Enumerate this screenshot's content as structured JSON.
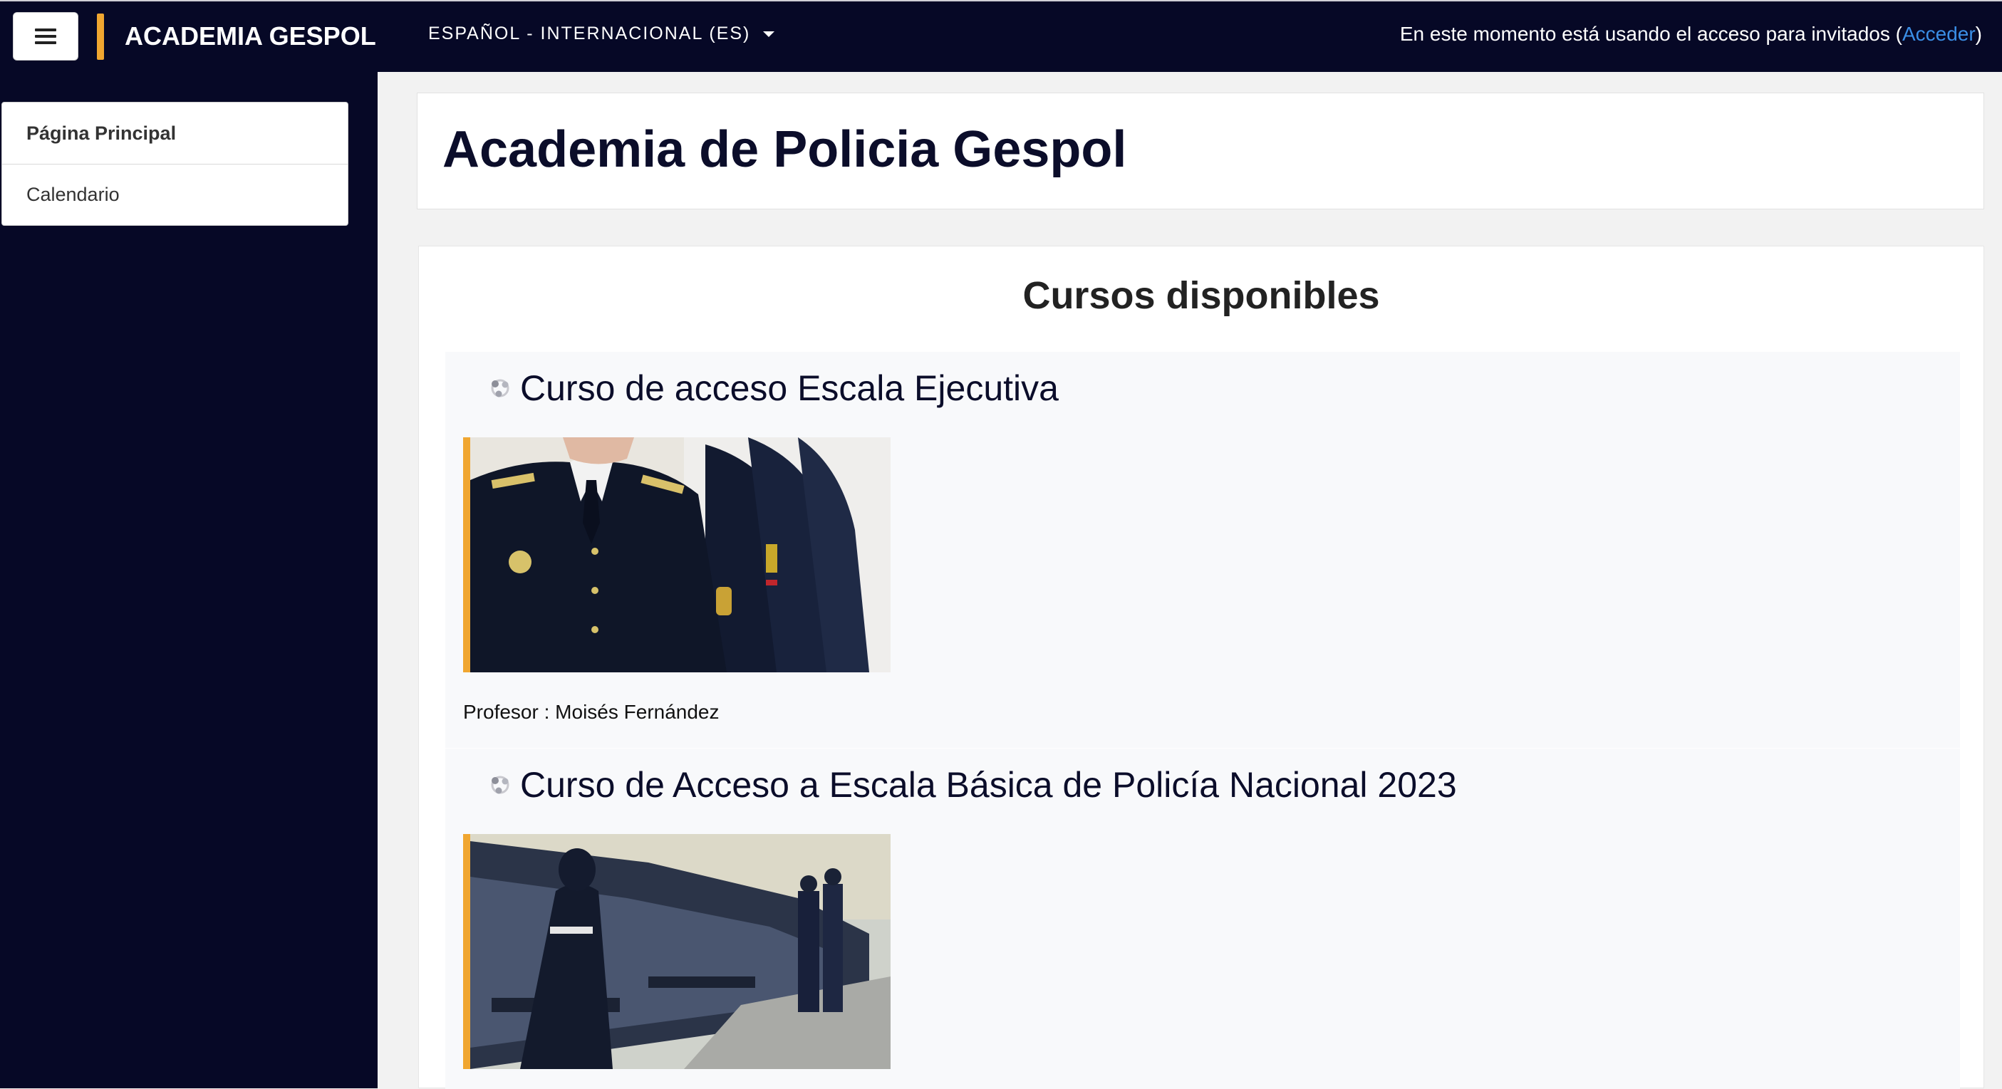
{
  "navbar": {
    "brand": "ACADEMIA GESPOL",
    "language": "ESPAÑOL - INTERNACIONAL (ES)",
    "guest_text": "En este momento está usando el acceso para invitados (",
    "login_link": "Acceder",
    "guest_close": ")"
  },
  "sidebar": {
    "items": [
      {
        "label": "Página Principal"
      },
      {
        "label": "Calendario"
      }
    ]
  },
  "main": {
    "page_title": "Academia de Policia Gespol",
    "section_title": "Cursos disponibles",
    "courses": [
      {
        "title": "Curso de acceso Escala Ejecutiva",
        "teacher_label": "Profesor",
        "teacher_name": "Moisés Fernández"
      },
      {
        "title": "Curso de Acceso a Escala Básica de Policía Nacional 2023"
      }
    ]
  },
  "colors": {
    "navbar_bg": "#060826",
    "accent": "#f0a630",
    "link": "#3a8ee6"
  },
  "icons": [
    "menu-icon",
    "caret-down-icon",
    "course-icon"
  ]
}
